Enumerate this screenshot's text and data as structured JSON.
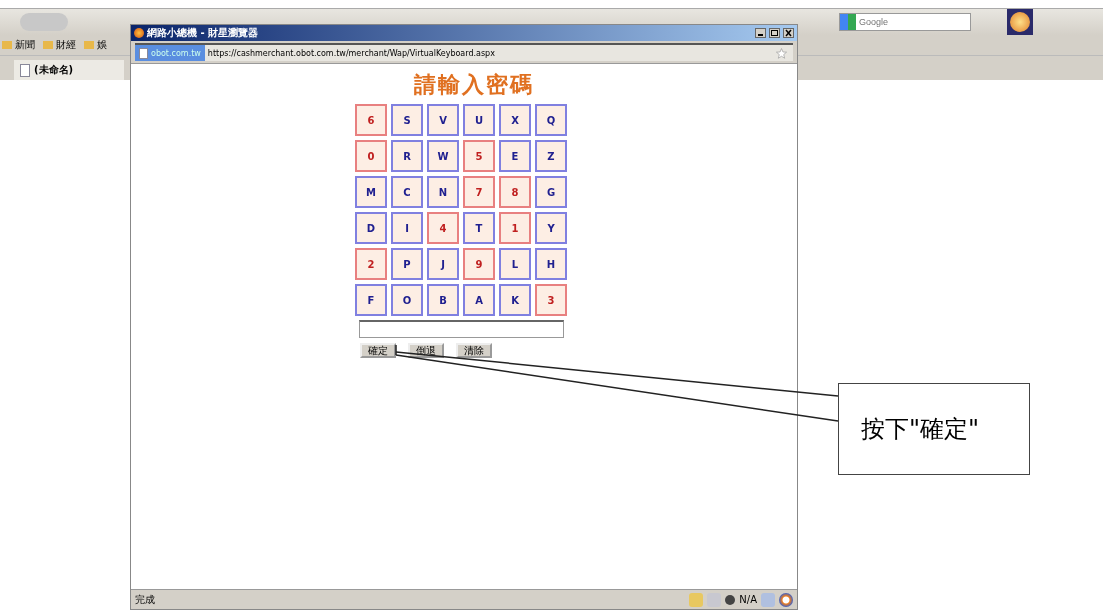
{
  "browser": {
    "search_placeholder": "Google",
    "bookmarks": [
      "新聞",
      "財經",
      "娛"
    ],
    "tab": "(未命名)"
  },
  "popup": {
    "title": "網路小總機 - 財星瀏覽器",
    "site_badge": "obot.com.tw",
    "url": "https://cashmerchant.obot.com.tw/merchant/Wap/VirtualKeyboard.aspx",
    "heading": "請輸入密碼",
    "keys": [
      {
        "label": "6",
        "kind": "digit"
      },
      {
        "label": "S",
        "kind": "letter"
      },
      {
        "label": "V",
        "kind": "letter"
      },
      {
        "label": "U",
        "kind": "letter"
      },
      {
        "label": "X",
        "kind": "letter"
      },
      {
        "label": "Q",
        "kind": "letter"
      },
      {
        "label": "0",
        "kind": "digit"
      },
      {
        "label": "R",
        "kind": "letter"
      },
      {
        "label": "W",
        "kind": "letter"
      },
      {
        "label": "5",
        "kind": "digit"
      },
      {
        "label": "E",
        "kind": "letter"
      },
      {
        "label": "Z",
        "kind": "letter"
      },
      {
        "label": "M",
        "kind": "letter"
      },
      {
        "label": "C",
        "kind": "letter"
      },
      {
        "label": "N",
        "kind": "letter"
      },
      {
        "label": "7",
        "kind": "digit"
      },
      {
        "label": "8",
        "kind": "digit"
      },
      {
        "label": "G",
        "kind": "letter"
      },
      {
        "label": "D",
        "kind": "letter"
      },
      {
        "label": "I",
        "kind": "letter"
      },
      {
        "label": "4",
        "kind": "digit"
      },
      {
        "label": "T",
        "kind": "letter"
      },
      {
        "label": "1",
        "kind": "digit"
      },
      {
        "label": "Y",
        "kind": "letter"
      },
      {
        "label": "2",
        "kind": "digit"
      },
      {
        "label": "P",
        "kind": "letter"
      },
      {
        "label": "J",
        "kind": "letter"
      },
      {
        "label": "9",
        "kind": "digit"
      },
      {
        "label": "L",
        "kind": "letter"
      },
      {
        "label": "H",
        "kind": "letter"
      },
      {
        "label": "F",
        "kind": "letter"
      },
      {
        "label": "O",
        "kind": "letter"
      },
      {
        "label": "B",
        "kind": "letter"
      },
      {
        "label": "A",
        "kind": "letter"
      },
      {
        "label": "K",
        "kind": "letter"
      },
      {
        "label": "3",
        "kind": "digit"
      }
    ],
    "buttons": [
      "確定",
      "倒退",
      "清除"
    ],
    "status": "完成",
    "status_zone": "N/A"
  },
  "callout": {
    "text": "按下\"確定\""
  }
}
